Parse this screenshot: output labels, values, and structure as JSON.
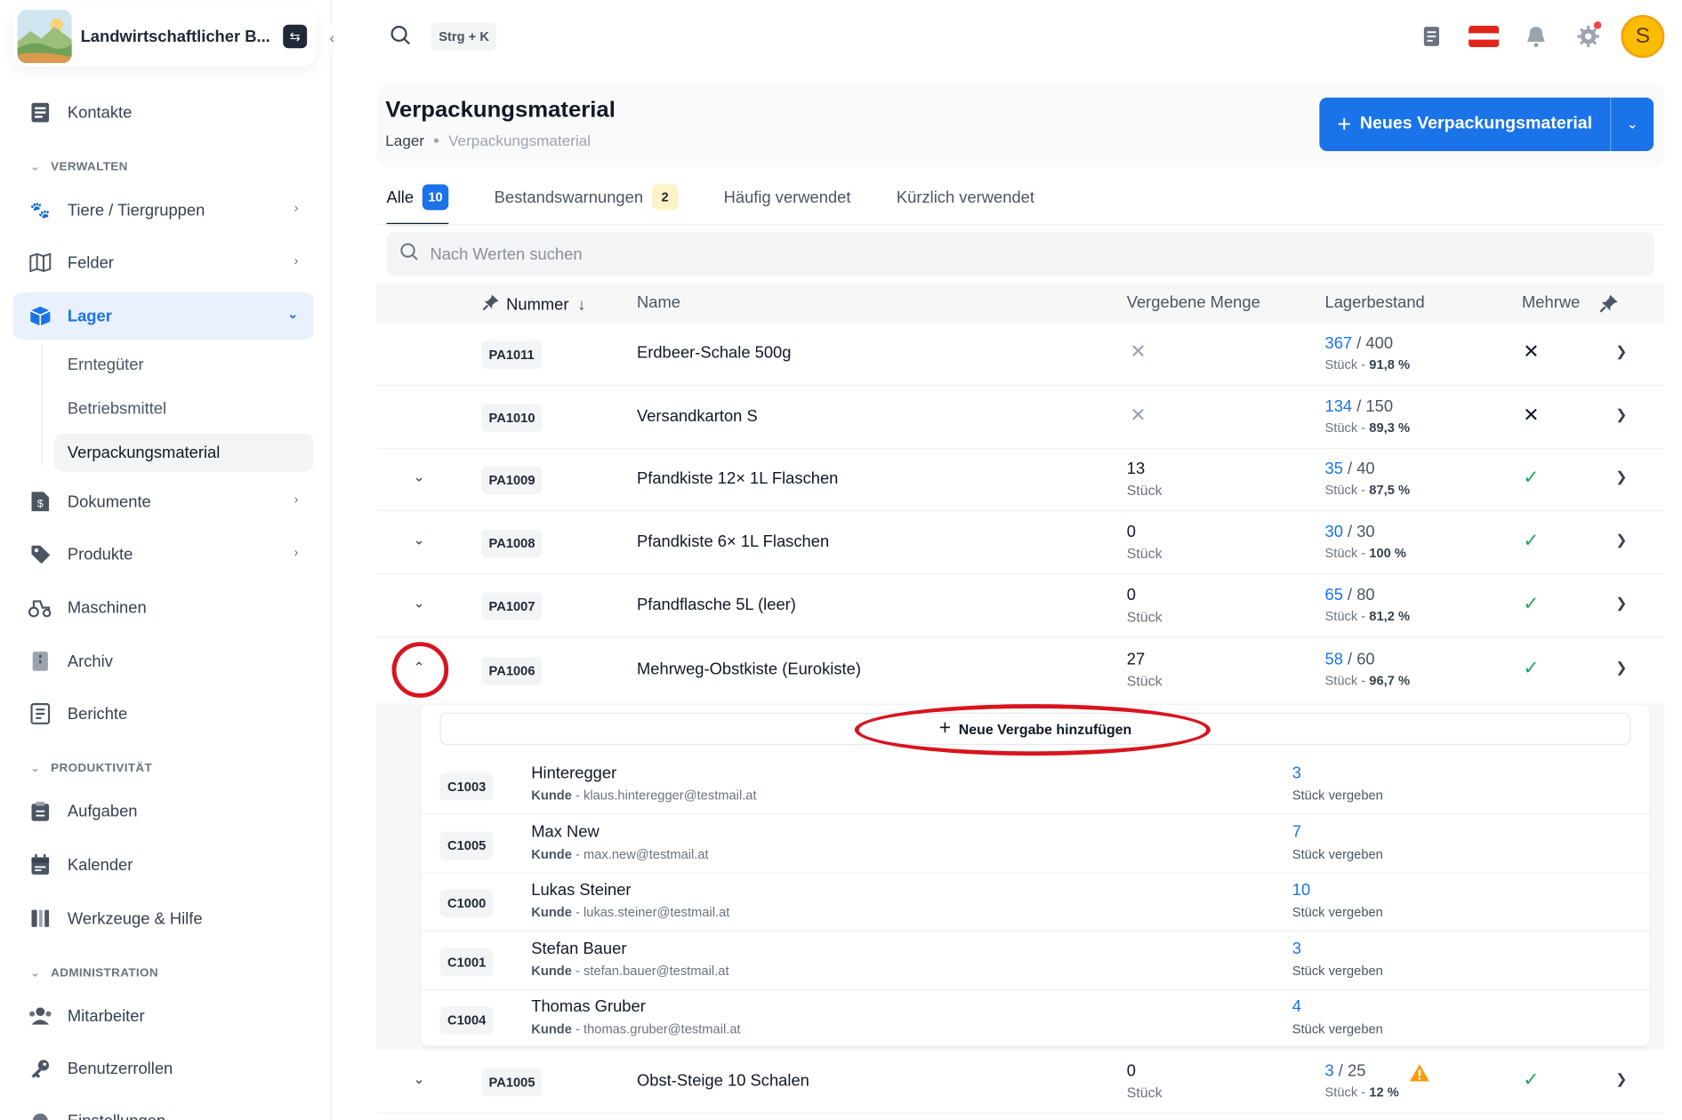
{
  "app": {
    "name": "Landwirtschaftlicher B..."
  },
  "topbar": {
    "shortcut": "Strg + K",
    "avatar_initial": "S"
  },
  "sidebar": {
    "items_top": [
      {
        "label": "Kontakte"
      }
    ],
    "sections": [
      {
        "label": "VERWALTEN"
      },
      {
        "label": "PRODUKTIVITÄT"
      },
      {
        "label": "ADMINISTRATION"
      }
    ],
    "manage": [
      {
        "label": "Tiere / Tiergruppen"
      },
      {
        "label": "Felder"
      },
      {
        "label": "Lager"
      },
      {
        "label": "Dokumente"
      },
      {
        "label": "Produkte"
      },
      {
        "label": "Maschinen"
      },
      {
        "label": "Archiv"
      },
      {
        "label": "Berichte"
      }
    ],
    "lager_sub": [
      {
        "label": "Erntegüter"
      },
      {
        "label": "Betriebsmittel"
      },
      {
        "label": "Verpackungsmaterial"
      }
    ],
    "productivity": [
      {
        "label": "Aufgaben"
      },
      {
        "label": "Kalender"
      },
      {
        "label": "Werkzeuge & Hilfe"
      }
    ],
    "admin": [
      {
        "label": "Mitarbeiter"
      },
      {
        "label": "Benutzerrollen"
      },
      {
        "label": "Einstellungen"
      }
    ]
  },
  "header": {
    "title": "Verpackungsmaterial",
    "breadcrumb": [
      "Lager",
      "Verpackungsmaterial"
    ],
    "primary_button": "Neues Verpackungsmaterial"
  },
  "tabs": [
    {
      "label": "Alle",
      "count": "10"
    },
    {
      "label": "Bestandswarnungen",
      "count": "2"
    },
    {
      "label": "Häufig verwendet"
    },
    {
      "label": "Kürzlich verwendet"
    }
  ],
  "search": {
    "placeholder": "Nach Werten suchen"
  },
  "table": {
    "columns": [
      "Nummer",
      "Name",
      "Vergebene Menge",
      "Lagerbestand",
      "Mehrwe"
    ],
    "rows": [
      {
        "code": "PA1011",
        "name": "Erdbeer-Schale 500g",
        "stock_avail": "367",
        "stock_total": "/ 400",
        "stock_unit": "Stück",
        "stock_pct": "91,8 %"
      },
      {
        "code": "PA1010",
        "name": "Versandkarton S",
        "stock_avail": "134",
        "stock_total": "/ 150",
        "stock_unit": "Stück",
        "stock_pct": "89,3 %"
      },
      {
        "code": "PA1009",
        "name": "Pfandkiste 12× 1L Flaschen",
        "qty": "13",
        "qty_unit": "Stück",
        "stock_avail": "35",
        "stock_total": "/ 40",
        "stock_unit": "Stück",
        "stock_pct": "87,5 %"
      },
      {
        "code": "PA1008",
        "name": "Pfandkiste 6× 1L Flaschen",
        "qty": "0",
        "qty_unit": "Stück",
        "stock_avail": "30",
        "stock_total": "/ 30",
        "stock_unit": "Stück",
        "stock_pct": "100 %"
      },
      {
        "code": "PA1007",
        "name": "Pfandflasche 5L (leer)",
        "qty": "0",
        "qty_unit": "Stück",
        "stock_avail": "65",
        "stock_total": "/ 80",
        "stock_unit": "Stück",
        "stock_pct": "81,2 %"
      },
      {
        "code": "PA1006",
        "name": "Mehrweg-Obstkiste (Eurokiste)",
        "qty": "27",
        "qty_unit": "Stück",
        "stock_avail": "58",
        "stock_total": "/ 60",
        "stock_unit": "Stück",
        "stock_pct": "96,7 %"
      },
      {
        "code": "PA1005",
        "name": "Obst-Steige 10 Schalen",
        "qty": "0",
        "qty_unit": "Stück",
        "stock_avail": "3",
        "stock_total": "/ 25",
        "stock_unit": "Stück",
        "stock_pct": "12 %"
      }
    ]
  },
  "assignments": {
    "add_button": "Neue Vergabe hinzufügen",
    "kunde_label": "Kunde",
    "count_label": "Stück vergeben",
    "rows": [
      {
        "code": "C1003",
        "name": "Hinteregger",
        "email": "klaus.hinteregger@testmail.at",
        "count": "3"
      },
      {
        "code": "C1005",
        "name": "Max New",
        "email": "max.new@testmail.at",
        "count": "7"
      },
      {
        "code": "C1000",
        "name": "Lukas Steiner",
        "email": "lukas.steiner@testmail.at",
        "count": "10"
      },
      {
        "code": "C1001",
        "name": "Stefan Bauer",
        "email": "stefan.bauer@testmail.at",
        "count": "3"
      },
      {
        "code": "C1004",
        "name": "Thomas Gruber",
        "email": "thomas.gruber@testmail.at",
        "count": "4"
      }
    ]
  },
  "colors": {
    "accent": "#1a73e8",
    "success": "#22a559",
    "warning": "#f59e0b",
    "highlight": "#d9141e"
  }
}
